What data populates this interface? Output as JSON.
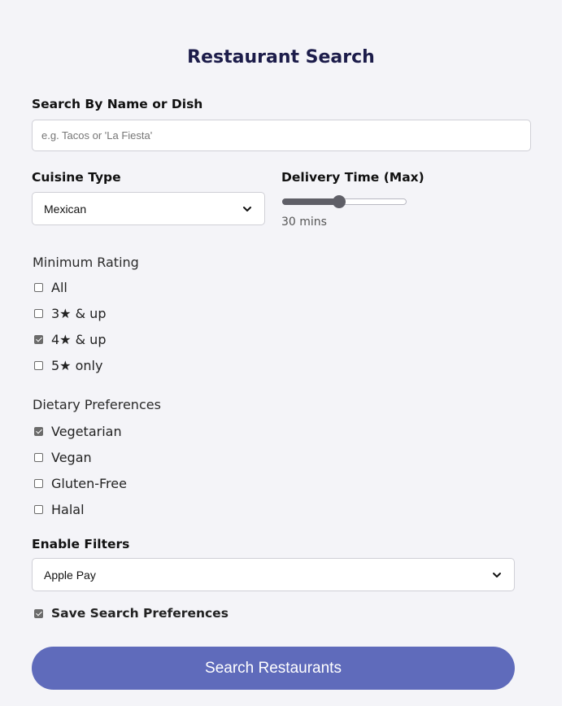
{
  "page": {
    "title": "Restaurant Search"
  },
  "search": {
    "label": "Search By Name or Dish",
    "placeholder": "e.g. Tacos or 'La Fiesta'",
    "value": ""
  },
  "cuisine": {
    "label": "Cuisine Type",
    "selected": "Mexican"
  },
  "delivery": {
    "label": "Delivery Time (Max)",
    "value_label": "30 mins",
    "slider_fraction": 0.45
  },
  "rating": {
    "label": "Minimum Rating",
    "options": [
      {
        "label": "All",
        "checked": false
      },
      {
        "label": "3★ & up",
        "checked": false
      },
      {
        "label": "4★ & up",
        "checked": true
      },
      {
        "label": "5★ only",
        "checked": false
      }
    ]
  },
  "dietary": {
    "label": "Dietary Preferences",
    "options": [
      {
        "label": "Vegetarian",
        "checked": true
      },
      {
        "label": "Vegan",
        "checked": false
      },
      {
        "label": "Gluten-Free",
        "checked": false
      },
      {
        "label": "Halal",
        "checked": false
      }
    ]
  },
  "filters": {
    "label": "Enable Filters",
    "selected": "Apple Pay"
  },
  "save_prefs": {
    "label": "Save Search Preferences",
    "checked": true
  },
  "submit": {
    "label": "Search Restaurants"
  },
  "icons": {
    "select_arrow": "chevron-down-icon",
    "check_mark": "check-icon"
  },
  "colors": {
    "panel_bg": "#f4f4f8",
    "title": "#1c1c4a",
    "button_bg": "#5f6bbb",
    "button_text": "#ffffff",
    "control_accent": "#5f5f67"
  }
}
